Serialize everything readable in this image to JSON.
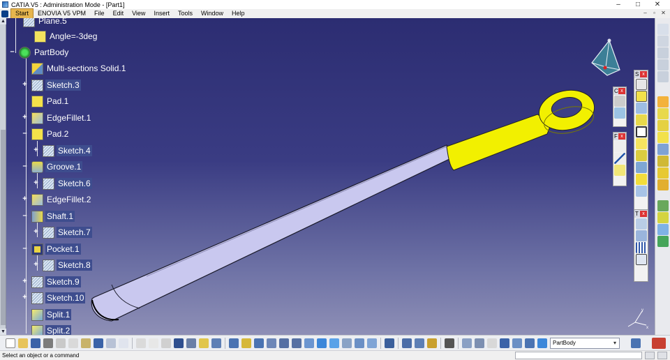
{
  "window": {
    "title": "CATIA V5 : Administration Mode - [Part1]",
    "controls": [
      "–",
      "□",
      "✕"
    ]
  },
  "menubar": {
    "items": [
      "Start",
      "ENOVIA V5 VPM",
      "File",
      "Edit",
      "View",
      "Insert",
      "Tools",
      "Window",
      "Help"
    ],
    "mdi_controls": [
      "–",
      "▫",
      "✕"
    ]
  },
  "tree": {
    "nodes": [
      {
        "label": "Plane.5",
        "icon": "plane-icon"
      },
      {
        "label": "Angle=-3deg",
        "icon": "angle-parameter-icon"
      },
      {
        "label": "PartBody",
        "icon": "partbody-gear-icon"
      },
      {
        "label": "Multi-sections Solid.1",
        "icon": "multi-sections-solid-icon"
      },
      {
        "label": "Sketch.3",
        "icon": "sketch-icon"
      },
      {
        "label": "Pad.1",
        "icon": "pad-icon"
      },
      {
        "label": "EdgeFillet.1",
        "icon": "edge-fillet-icon"
      },
      {
        "label": "Pad.2",
        "icon": "pad-icon"
      },
      {
        "label": "Sketch.4",
        "icon": "sketch-icon"
      },
      {
        "label": "Groove.1",
        "icon": "groove-icon"
      },
      {
        "label": "Sketch.6",
        "icon": "sketch-icon"
      },
      {
        "label": "EdgeFillet.2",
        "icon": "edge-fillet-icon"
      },
      {
        "label": "Shaft.1",
        "icon": "shaft-icon"
      },
      {
        "label": "Sketch.7",
        "icon": "sketch-icon"
      },
      {
        "label": "Pocket.1",
        "icon": "pocket-icon"
      },
      {
        "label": "Sketch.8",
        "icon": "sketch-icon"
      },
      {
        "label": "Sketch.9",
        "icon": "sketch-icon"
      },
      {
        "label": "Sketch.10",
        "icon": "sketch-icon"
      },
      {
        "label": "Split.1",
        "icon": "split-icon"
      },
      {
        "label": "Split.2",
        "icon": "split-icon"
      }
    ]
  },
  "palettes": {
    "sketch": {
      "letter": "S",
      "close": "x"
    },
    "c": {
      "letter": "C",
      "close": "x"
    },
    "f": {
      "letter": "F",
      "close": "x"
    },
    "t": {
      "letter": "T",
      "close": "x"
    }
  },
  "bottombar": {
    "current_body": "PartBody"
  },
  "statusbar": {
    "message": "Select an object or a command"
  },
  "colors": {
    "viewport_top": "#2c2d72",
    "viewport_bottom": "#8e8fb6",
    "part_yellow": "#f2f000",
    "part_lilac": "#c9c8ef"
  }
}
